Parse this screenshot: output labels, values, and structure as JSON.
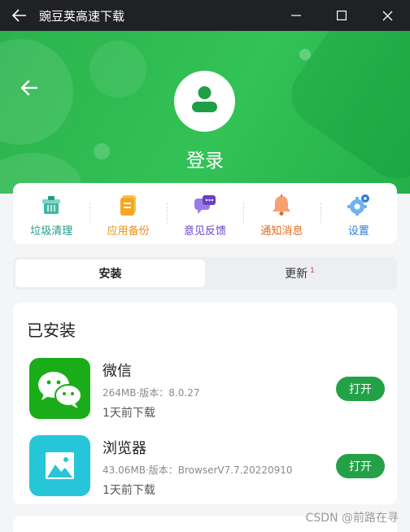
{
  "window": {
    "title": "豌豆荚高速下载",
    "controls": [
      "minimize",
      "maximize",
      "close"
    ]
  },
  "header": {
    "login_label": "登录",
    "colors": {
      "green": "#2bb34d"
    }
  },
  "quick_actions": [
    {
      "label": "垃圾清理",
      "icon": "trash-bin-icon",
      "color": "#1f9c8a"
    },
    {
      "label": "应用备份",
      "icon": "backup-icon",
      "color": "#e8901a"
    },
    {
      "label": "意见反馈",
      "icon": "feedback-icon",
      "color": "#6a3fc9"
    },
    {
      "label": "通知消息",
      "icon": "bell-icon",
      "color": "#e06a1c"
    },
    {
      "label": "设置",
      "icon": "gear-icon",
      "color": "#2a7fd6"
    }
  ],
  "tabs": [
    {
      "label": "安装",
      "active": true
    },
    {
      "label": "更新",
      "badge": "1",
      "active": false
    }
  ],
  "installed": {
    "title": "已安装",
    "apps": [
      {
        "name": "微信",
        "meta": "264MB·版本：8.0.27",
        "time": "1天前下载",
        "action": "打开",
        "icon": "wechat-icon"
      },
      {
        "name": "浏览器",
        "meta": "43.06MB·版本：BrowserV7.7.20220910",
        "time": "1天前下载",
        "action": "打开",
        "icon": "browser-icon"
      }
    ]
  },
  "watermark": "CSDN @前路在寻"
}
